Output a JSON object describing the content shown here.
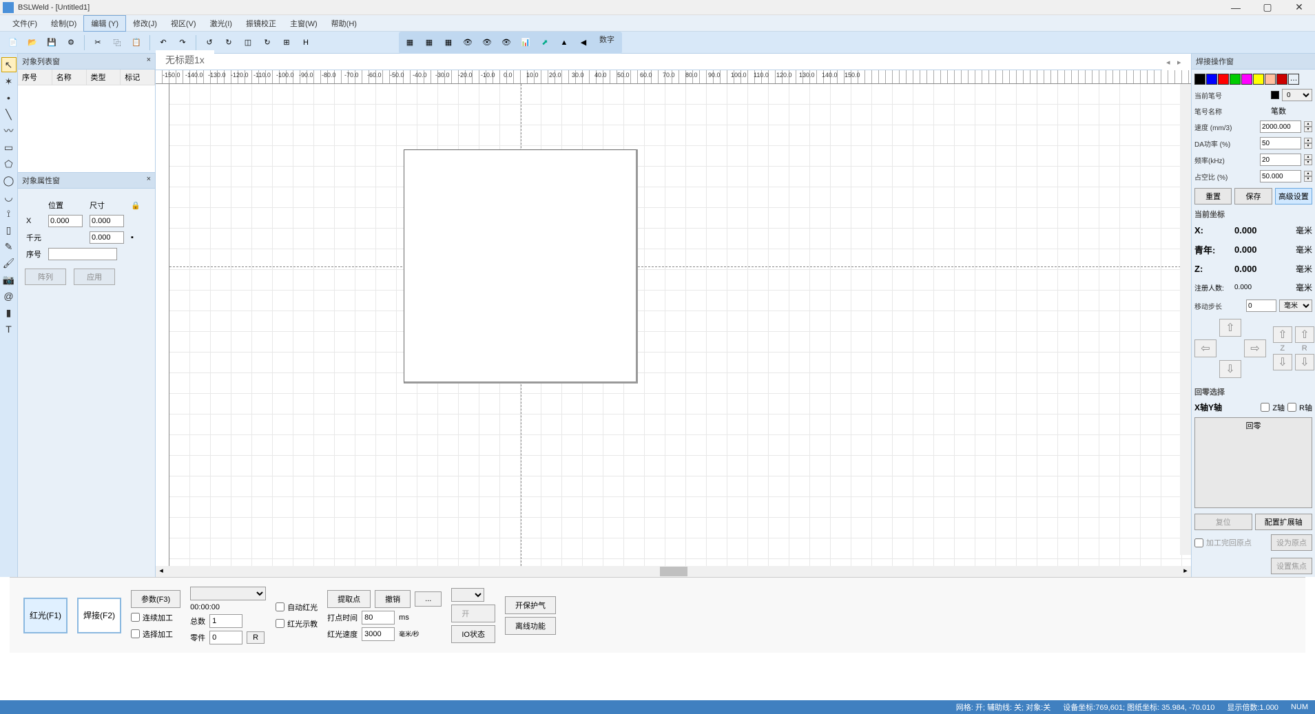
{
  "title": "BSLWeld - [Untitled1]",
  "menus": [
    "文件(F)",
    "绘制(D)",
    "编辑 (Y)",
    "修改(J)",
    "视区(V)",
    "激光(I)",
    "振镜校正",
    "主窗(W)",
    "帮助(H)"
  ],
  "menus_active_index": 2,
  "toolbar2_text": "数字",
  "doc_tab": "无标题1x",
  "left_panels": {
    "obj_list_title": "对象列表窗",
    "obj_list_cols": [
      "序号",
      "名称",
      "类型",
      "标记"
    ],
    "prop_title": "对象属性窗",
    "pos_label": "位置",
    "size_label": "尺寸",
    "x_label": "X",
    "x_pos": "0.000",
    "x_size": "0.000",
    "y_label": "千元",
    "y_size": "0.000",
    "seq_label": "序号",
    "btn_array": "阵列",
    "btn_apply": "应用"
  },
  "ruler_ticks": [
    "-150.0",
    "-140.0",
    "-130.0",
    "-120.0",
    "-110.0",
    "-100.0",
    "-90.0",
    "-80.0",
    "-70.0",
    "-60.0",
    "-50.0",
    "-40.0",
    "-30.0",
    "-20.0",
    "-10.0",
    "0.0",
    "10.0",
    "20.0",
    "30.0",
    "40.0",
    "50.0",
    "60.0",
    "70.0",
    "80.0",
    "90.0",
    "100.0",
    "110.0",
    "120.0",
    "130.0",
    "140.0",
    "150.0"
  ],
  "right": {
    "title": "焊接操作窗",
    "colors": [
      "#000000",
      "#0000ff",
      "#ff0000",
      "#00cc00",
      "#ff00ff",
      "#ffff00",
      "#ffc0a0",
      "#cc0000"
    ],
    "pen_label": "当前笔号",
    "pen_value": "0",
    "pen_name_label": "笔号名称",
    "pen_name_value": "笔数",
    "speed_label": "速度 (mm/3)",
    "speed_value": "2000.000",
    "power_label": "DA功率 (%)",
    "power_value": "50",
    "freq_label": "频率(kHz)",
    "freq_value": "20",
    "duty_label": "占空比 (%)",
    "duty_value": "50.000",
    "btn_reset": "重置",
    "btn_save": "保存",
    "btn_adv": "高级设置",
    "coord_title": "当前坐标",
    "coord_x_label": "X:",
    "coord_x_value": "0.000",
    "coord_y_label": "青年:",
    "coord_y_value": "0.000",
    "coord_z_label": "Z:",
    "coord_z_value": "0.000",
    "coord_r_label": "注册人数:",
    "coord_r_value": "0.000",
    "unit": "毫米",
    "step_label": "移动步长",
    "step_value": "0",
    "step_unit": "毫米",
    "z_label": "Z",
    "r_label": "R",
    "zero_title": "回零选择",
    "xy_axis": "X轴Y轴",
    "z_axis": "Z轴",
    "r_axis": "R轴",
    "btn_zero": "回零",
    "btn_reset2": "复位",
    "btn_config": "配置扩展轴",
    "chk_origin": "加工完回原点",
    "btn_set_origin": "设为原点",
    "btn_set_focus": "设置焦点"
  },
  "bottom": {
    "btn_red": "红光(F1)",
    "btn_weld": "焊接(F2)",
    "btn_param": "参数(F3)",
    "chk_cont": "连续加工",
    "chk_sel": "选择加工",
    "time": "00:00:00",
    "total_label": "总数",
    "total_value": "1",
    "parts_label": "零件",
    "parts_value": "0",
    "btn_r": "R",
    "chk_auto_red": "自动红光",
    "chk_red_teach": "红光示教",
    "btn_getpoint": "提取点",
    "btn_undo": "撤销",
    "btn_more": "...",
    "dot_time_label": "打点时间",
    "dot_time_value": "80",
    "dot_time_unit": "ms",
    "red_speed_label": "红光速度",
    "red_speed_value": "3000",
    "red_speed_unit": "毫米/秒",
    "btn_open": "开",
    "btn_io": "IO状态",
    "btn_gas": "开保护气",
    "btn_offline": "离线功能"
  },
  "status": {
    "grid": "网格: 开; 辅助线: 关; 对象:关",
    "device": "设备坐标:769,601; 图纸坐标: 35.984, -70.010",
    "zoom": "显示倍数:1.000",
    "num": "NUM"
  }
}
